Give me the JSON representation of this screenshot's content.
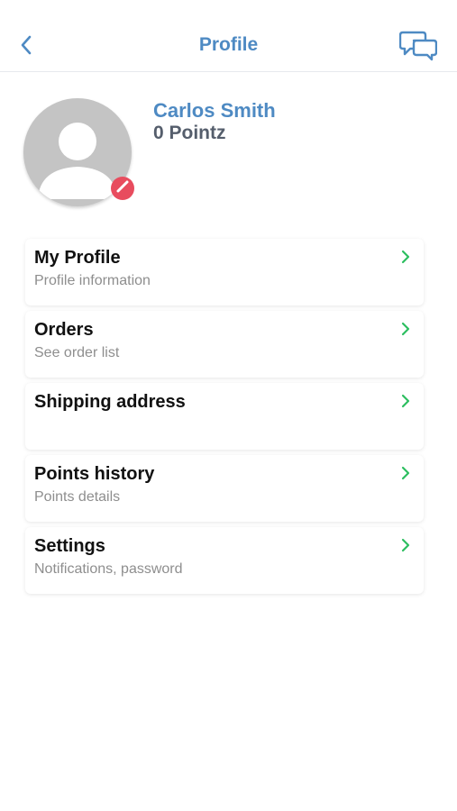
{
  "header": {
    "title": "Profile",
    "back_icon": "chevron-left-icon",
    "chat_icon": "chat-bubbles-icon",
    "accent_color": "#4e8ac3"
  },
  "profile": {
    "name": "Carlos Smith",
    "points": "0 Pointz",
    "avatar_icon": "person-placeholder-icon",
    "edit_badge_icon": "edit-badge-icon",
    "badge_color": "#e84c5e"
  },
  "menu": {
    "chevron_color": "#2dbe60",
    "items": [
      {
        "title": "My Profile",
        "subtitle": "Profile information"
      },
      {
        "title": "Orders",
        "subtitle": "See order list"
      },
      {
        "title": "Shipping address",
        "subtitle": ""
      },
      {
        "title": "Points history",
        "subtitle": "Points details"
      },
      {
        "title": "Settings",
        "subtitle": "Notifications, password"
      }
    ]
  }
}
